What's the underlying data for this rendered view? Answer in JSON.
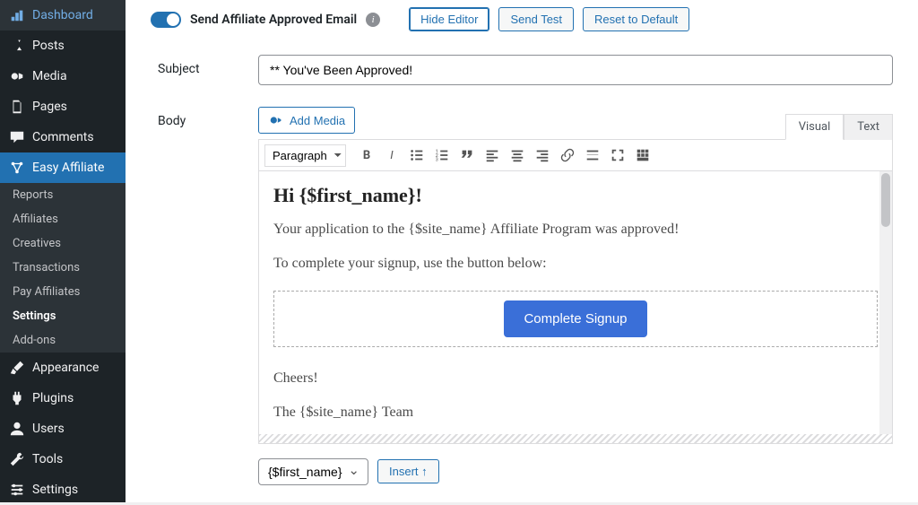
{
  "sidebar": {
    "items": [
      {
        "icon": "dashboard",
        "label": "Dashboard"
      },
      {
        "icon": "pin",
        "label": "Posts"
      },
      {
        "icon": "media",
        "label": "Media"
      },
      {
        "icon": "page",
        "label": "Pages"
      },
      {
        "icon": "comment",
        "label": "Comments"
      }
    ],
    "active": {
      "icon": "affiliate",
      "label": "Easy Affiliate"
    },
    "subs": [
      {
        "label": "Reports"
      },
      {
        "label": "Affiliates"
      },
      {
        "label": "Creatives"
      },
      {
        "label": "Transactions"
      },
      {
        "label": "Pay Affiliates"
      },
      {
        "label": "Settings",
        "active": true
      },
      {
        "label": "Add-ons"
      }
    ],
    "bottom": [
      {
        "icon": "appearance",
        "label": "Appearance"
      },
      {
        "icon": "plugin",
        "label": "Plugins"
      },
      {
        "icon": "user",
        "label": "Users"
      },
      {
        "icon": "tool",
        "label": "Tools"
      },
      {
        "icon": "settings",
        "label": "Settings"
      }
    ]
  },
  "header": {
    "toggle_label": "Send Affiliate Approved Email",
    "buttons": {
      "hide": "Hide Editor",
      "test": "Send Test",
      "reset": "Reset to Default"
    }
  },
  "form": {
    "subject_label": "Subject",
    "subject_value": "** You've Been Approved!",
    "body_label": "Body",
    "add_media": "Add Media",
    "tabs": {
      "visual": "Visual",
      "text": "Text"
    },
    "format": "Paragraph",
    "content": {
      "heading": "Hi {$first_name}!",
      "p1": "Your application to the {$site_name} Affiliate Program was approved!",
      "p2": "To complete your signup, use the button below:",
      "cta": "Complete Signup",
      "p3": "Cheers!",
      "p4": "The {$site_name} Team"
    },
    "variable": "{$first_name}",
    "insert_btn": "Insert ↑"
  }
}
